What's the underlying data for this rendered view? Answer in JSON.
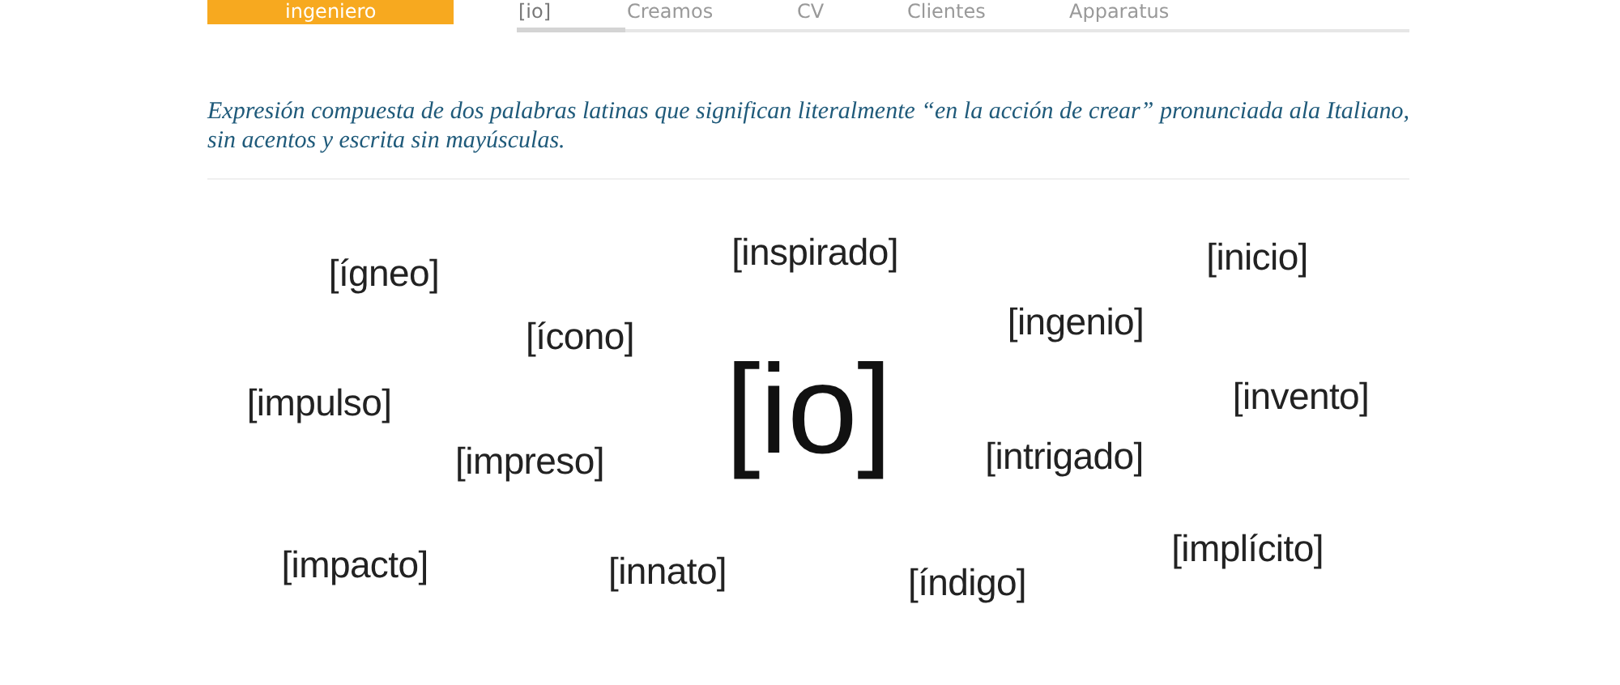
{
  "logo": {
    "text": "ingeniero"
  },
  "nav": [
    {
      "label": "[io]",
      "selected": true
    },
    {
      "label": "Creamos",
      "selected": false
    },
    {
      "label": "CV",
      "selected": false
    },
    {
      "label": "Clientes",
      "selected": false
    },
    {
      "label": "Apparatus",
      "selected": false
    }
  ],
  "description": "Expresión compuesta de dos palabras latinas que significan literalmente “en la acción de crear” pronunciada ala Italiano, sin acentos y escrita sin mayúsculas.",
  "word_cloud": [
    {
      "text": "[ígneo]",
      "kind": "word"
    },
    {
      "text": "[inspirado]",
      "kind": "word"
    },
    {
      "text": "[inicio]",
      "kind": "word"
    },
    {
      "text": "[ícono]",
      "kind": "word"
    },
    {
      "text": "[ingenio]",
      "kind": "word"
    },
    {
      "text": "[impulso]",
      "kind": "word"
    },
    {
      "text": "[io]",
      "kind": "center"
    },
    {
      "text": "[invento]",
      "kind": "word"
    },
    {
      "text": "[impreso]",
      "kind": "word"
    },
    {
      "text": "[intrigado]",
      "kind": "word"
    },
    {
      "text": "[impacto]",
      "kind": "word"
    },
    {
      "text": "[innato]",
      "kind": "word"
    },
    {
      "text": "[índigo]",
      "kind": "word"
    },
    {
      "text": "[implícito]",
      "kind": "word"
    }
  ]
}
